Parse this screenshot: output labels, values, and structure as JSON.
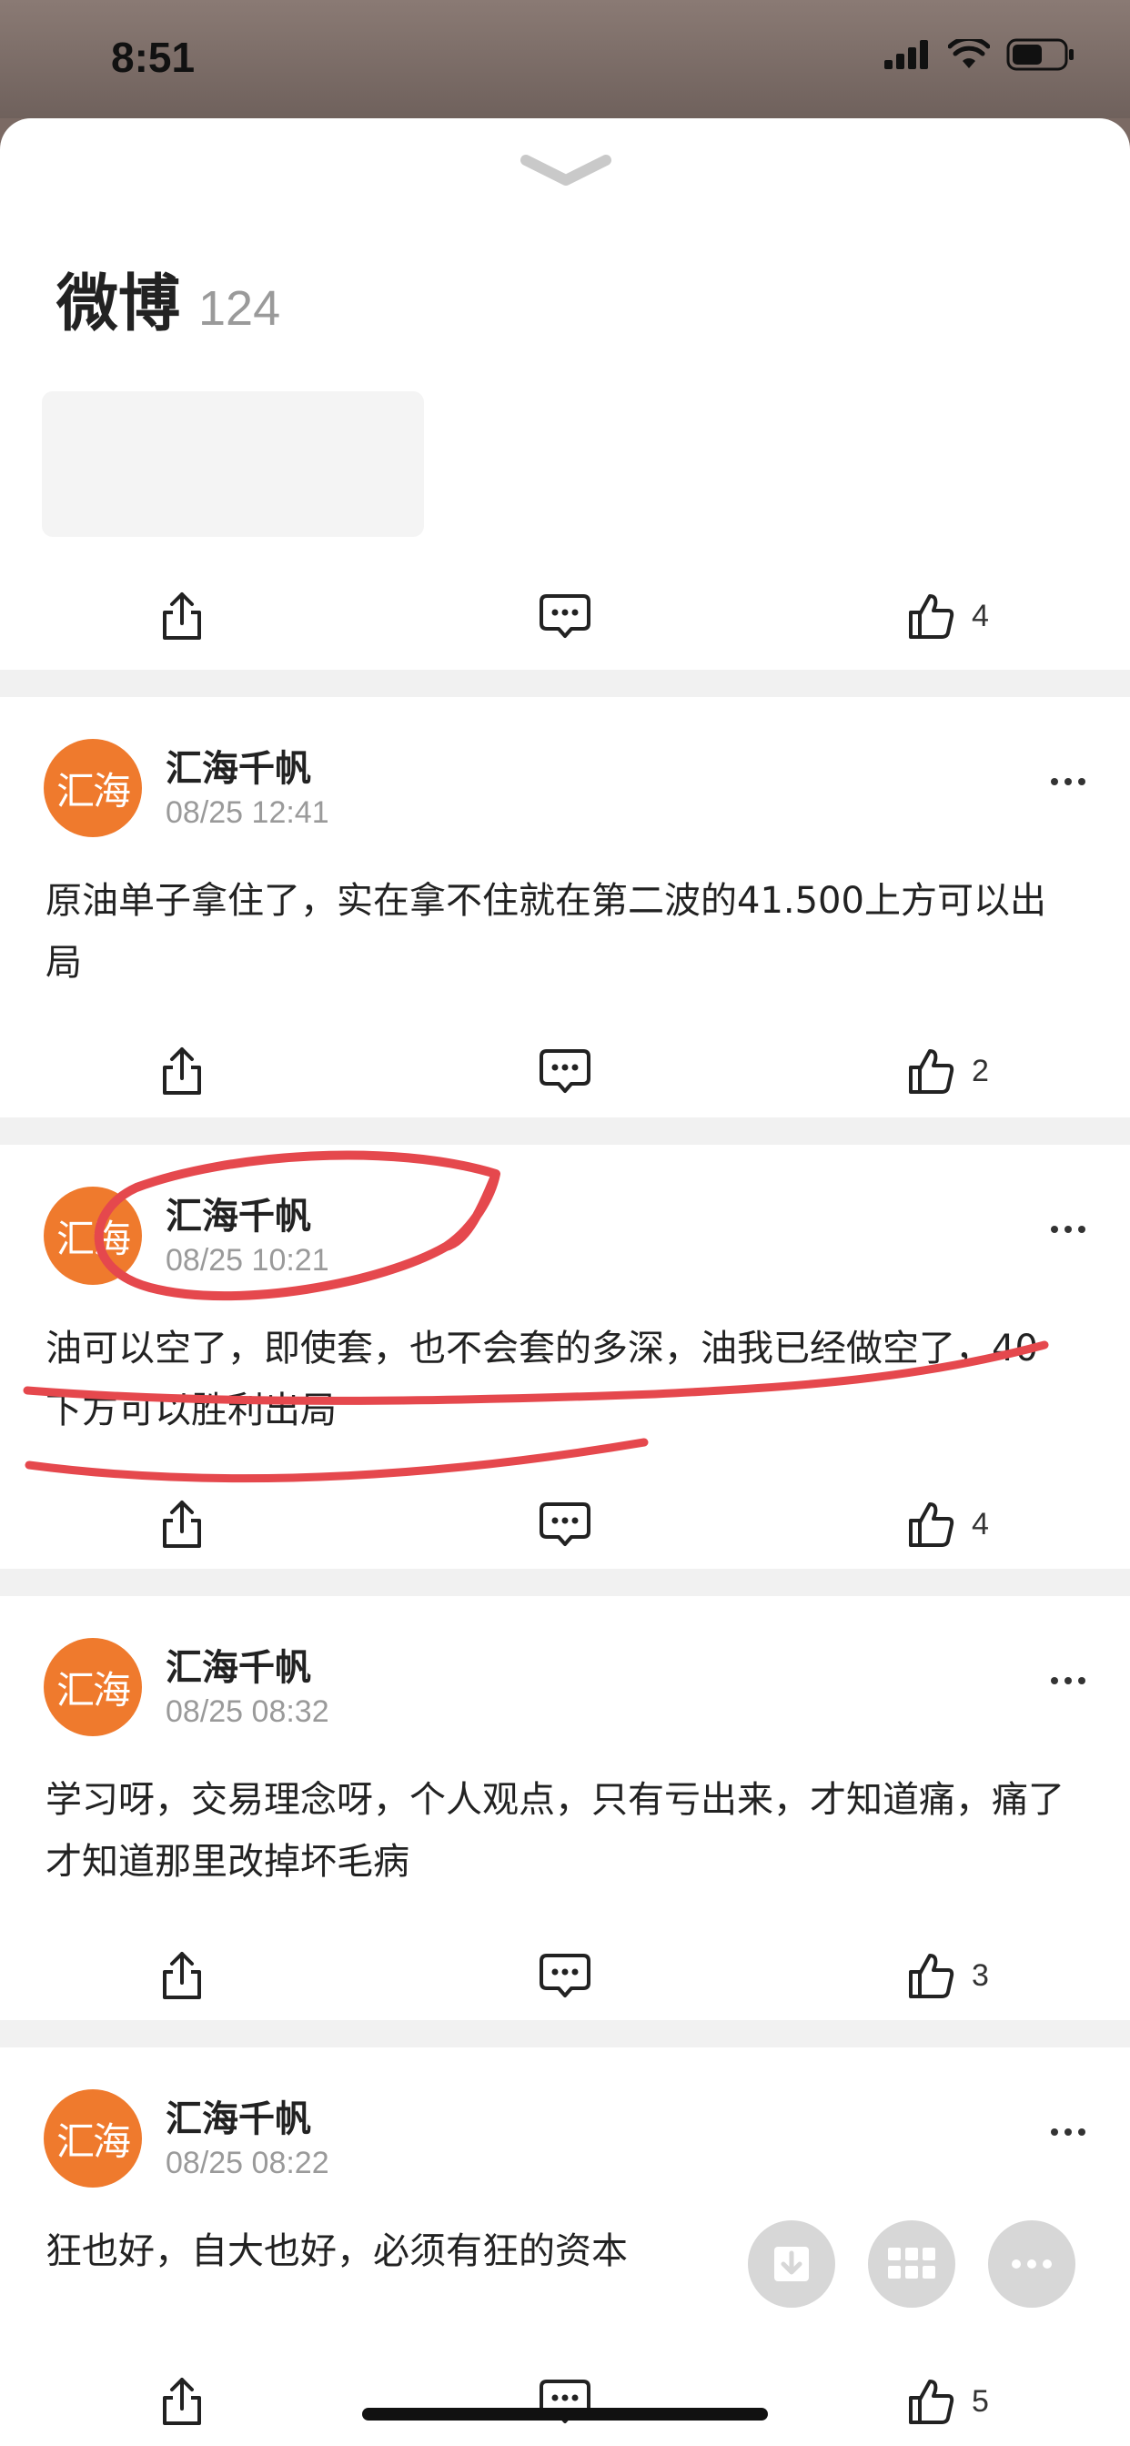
{
  "status_bar": {
    "time": "8:51"
  },
  "header": {
    "title": "微博",
    "count": "124"
  },
  "first_post": {
    "like_count": "4"
  },
  "posts": [
    {
      "avatar_text": "汇海",
      "author": "汇海千帆",
      "time": "08/25 12:41",
      "content": "原油单子拿住了，实在拿不住就在第二波的41.500上方可以出局",
      "like_count": "2"
    },
    {
      "avatar_text": "汇海",
      "author": "汇海千帆",
      "time": "08/25 10:21",
      "content": "油可以空了，即使套，也不会套的多深，油我已经做空了，40下方可以胜利出局",
      "like_count": "4"
    },
    {
      "avatar_text": "汇海",
      "author": "汇海千帆",
      "time": "08/25 08:32",
      "content": "学习呀，交易理念呀，个人观点，只有亏出来，才知道痛，痛了才知道那里改掉坏毛病",
      "like_count": "3"
    },
    {
      "avatar_text": "汇海",
      "author": "汇海千帆",
      "time": "08/25 08:22",
      "content": "狂也好，自大也好，必须有狂的资本",
      "like_count": "5"
    }
  ],
  "colors": {
    "avatar": "#ef7a2d",
    "annotation_red": "#e5484d",
    "divider": "#f1f1f1"
  },
  "icons": [
    "share-icon",
    "comment-icon",
    "thumbs-up-icon",
    "more-icon",
    "download-icon",
    "grid-icon",
    "chevron-down-icon"
  ]
}
